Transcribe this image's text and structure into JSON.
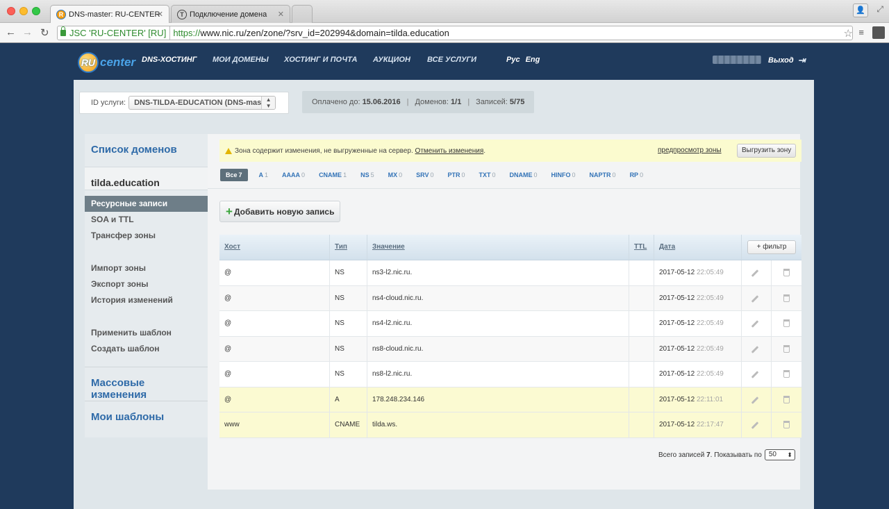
{
  "browser": {
    "tabs": [
      {
        "title": "DNS-master: RU-CENTER",
        "favicon": "R"
      },
      {
        "title": "Подключение домена",
        "favicon": "T"
      }
    ],
    "ev_name": "JSC 'RU-CENTER' [RU]",
    "url_scheme": "https://",
    "url_rest": "www.nic.ru/zen/zone/?srv_id=202994&domain=tilda.education"
  },
  "header": {
    "logo_ru": "RU",
    "logo_center": "center",
    "nav": [
      "DNS-ХОСТИНГ",
      "МОИ ДОМЕНЫ",
      "ХОСТИНГ И ПОЧТА",
      "АУКЦИОН",
      "ВСЕ УСЛУГИ"
    ],
    "lang": [
      "Рус",
      "Eng"
    ],
    "logout": "Выход"
  },
  "service": {
    "label": "ID услуги:",
    "selected": "DNS-TILDA-EDUCATION (DNS-master)",
    "paid_label": "Оплачено до:",
    "paid_value": "15.06.2016",
    "domains_label": "Доменов:",
    "domains_value": "1/1",
    "records_label": "Записей:",
    "records_value": "5/75"
  },
  "sidebar": {
    "domains_title": "Список доменов",
    "current_domain": "tilda.education",
    "menu": [
      "Ресурсные записи",
      "SOA и TTL",
      "Трансфер зоны",
      "Импорт зоны",
      "Экспорт зоны",
      "История изменений",
      "Применить шаблон",
      "Создать шаблон"
    ],
    "mass_changes": "Массовые изменения",
    "my_templates": "Мои шаблоны"
  },
  "alert": {
    "text": "Зона содержит изменения, не выгруженные на сервер.",
    "cancel_link": "Отменить изменения",
    "preview_link": "предпросмотр зоны",
    "export_button": "Выгрузить зону"
  },
  "filters": [
    {
      "label": "Все",
      "count": "7"
    },
    {
      "label": "A",
      "count": "1"
    },
    {
      "label": "AAAA",
      "count": "0"
    },
    {
      "label": "CNAME",
      "count": "1"
    },
    {
      "label": "NS",
      "count": "5"
    },
    {
      "label": "MX",
      "count": "0"
    },
    {
      "label": "SRV",
      "count": "0"
    },
    {
      "label": "PTR",
      "count": "0"
    },
    {
      "label": "TXT",
      "count": "0"
    },
    {
      "label": "DNAME",
      "count": "0"
    },
    {
      "label": "HINFO",
      "count": "0"
    },
    {
      "label": "NAPTR",
      "count": "0"
    },
    {
      "label": "RP",
      "count": "0"
    }
  ],
  "add_button": "Добавить новую запись",
  "table": {
    "columns": {
      "host": "Хост",
      "type": "Тип",
      "value": "Значение",
      "ttl": "TTL",
      "date": "Дата",
      "filter": "+ фильтр"
    },
    "rows": [
      {
        "host": "@",
        "type": "NS",
        "value": "ns3-l2.nic.ru.",
        "date": "2017-05-12",
        "time": "22:05:49",
        "changed": false
      },
      {
        "host": "@",
        "type": "NS",
        "value": "ns4-cloud.nic.ru.",
        "date": "2017-05-12",
        "time": "22:05:49",
        "changed": false
      },
      {
        "host": "@",
        "type": "NS",
        "value": "ns4-l2.nic.ru.",
        "date": "2017-05-12",
        "time": "22:05:49",
        "changed": false
      },
      {
        "host": "@",
        "type": "NS",
        "value": "ns8-cloud.nic.ru.",
        "date": "2017-05-12",
        "time": "22:05:49",
        "changed": false
      },
      {
        "host": "@",
        "type": "NS",
        "value": "ns8-l2.nic.ru.",
        "date": "2017-05-12",
        "time": "22:05:49",
        "changed": false
      },
      {
        "host": "@",
        "type": "A",
        "value": "178.248.234.146",
        "date": "2017-05-12",
        "time": "22:11:01",
        "changed": true
      },
      {
        "host": "www",
        "type": "CNAME",
        "value": "tilda.ws.",
        "date": "2017-05-12",
        "time": "22:17:47",
        "changed": true
      }
    ]
  },
  "footer": {
    "total_label": "Всего записей",
    "total_value": "7",
    "show_label": ". Показывать по",
    "per_page": "50"
  }
}
